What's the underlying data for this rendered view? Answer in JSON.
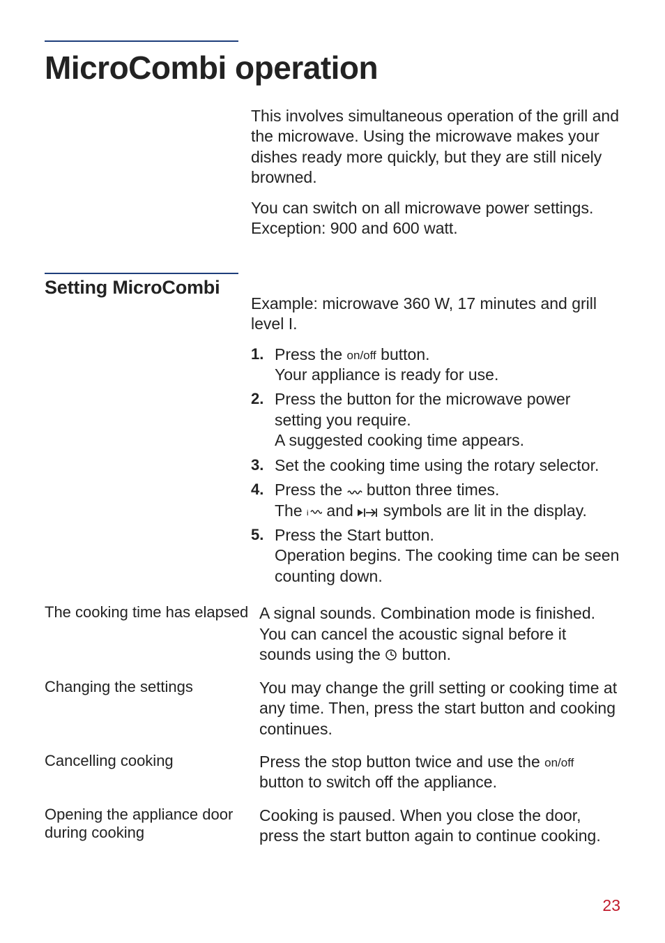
{
  "page_number": "23",
  "title": "MicroCombi operation",
  "intro": {
    "p1": "This involves simultaneous operation of the grill and the microwave. Using the microwave makes your dishes ready more quickly, but they are still nicely browned.",
    "p2": "You can switch on all microwave power settings. Exception: 900 and 600 watt."
  },
  "section": {
    "heading": "Setting MicroCombi",
    "example": "Example: microwave 360 W, 17 minutes and grill level I.",
    "steps": [
      {
        "a": "Press the ",
        "onoff": "on/off",
        "b": " button.",
        "c": "Your appliance is ready for use."
      },
      {
        "a": "Press the button for the microwave power setting you require.",
        "c": "A suggested cooking time appears."
      },
      {
        "a": "Set the cooking time using the rotary selector."
      },
      {
        "a": "Press the ",
        "b": " button three times.",
        "c_pre": "The ",
        "c_mid": " and ",
        "c_post": " symbols are lit in the display."
      },
      {
        "a": "Press the Start button.",
        "c": "Operation begins. The cooking time can be seen counting down."
      }
    ],
    "subs": [
      {
        "label": "The cooking time has elapsed",
        "text_pre": "A signal sounds. Combination mode is finished. You can cancel the acoustic signal before it sounds using the ",
        "text_post": " button."
      },
      {
        "label": "Changing the settings",
        "text": "You may change the grill setting or cooking time at any time. Then, press the start button and cooking continues."
      },
      {
        "label": "Cancelling cooking",
        "text_pre": "Press the stop button twice and use the ",
        "onoff": "on/off",
        "text_post": " button to switch off the appliance."
      },
      {
        "label": "Opening the appliance door during cooking",
        "text": "Cooking is paused. When you close the door, press the start button again to continue cooking."
      }
    ]
  }
}
